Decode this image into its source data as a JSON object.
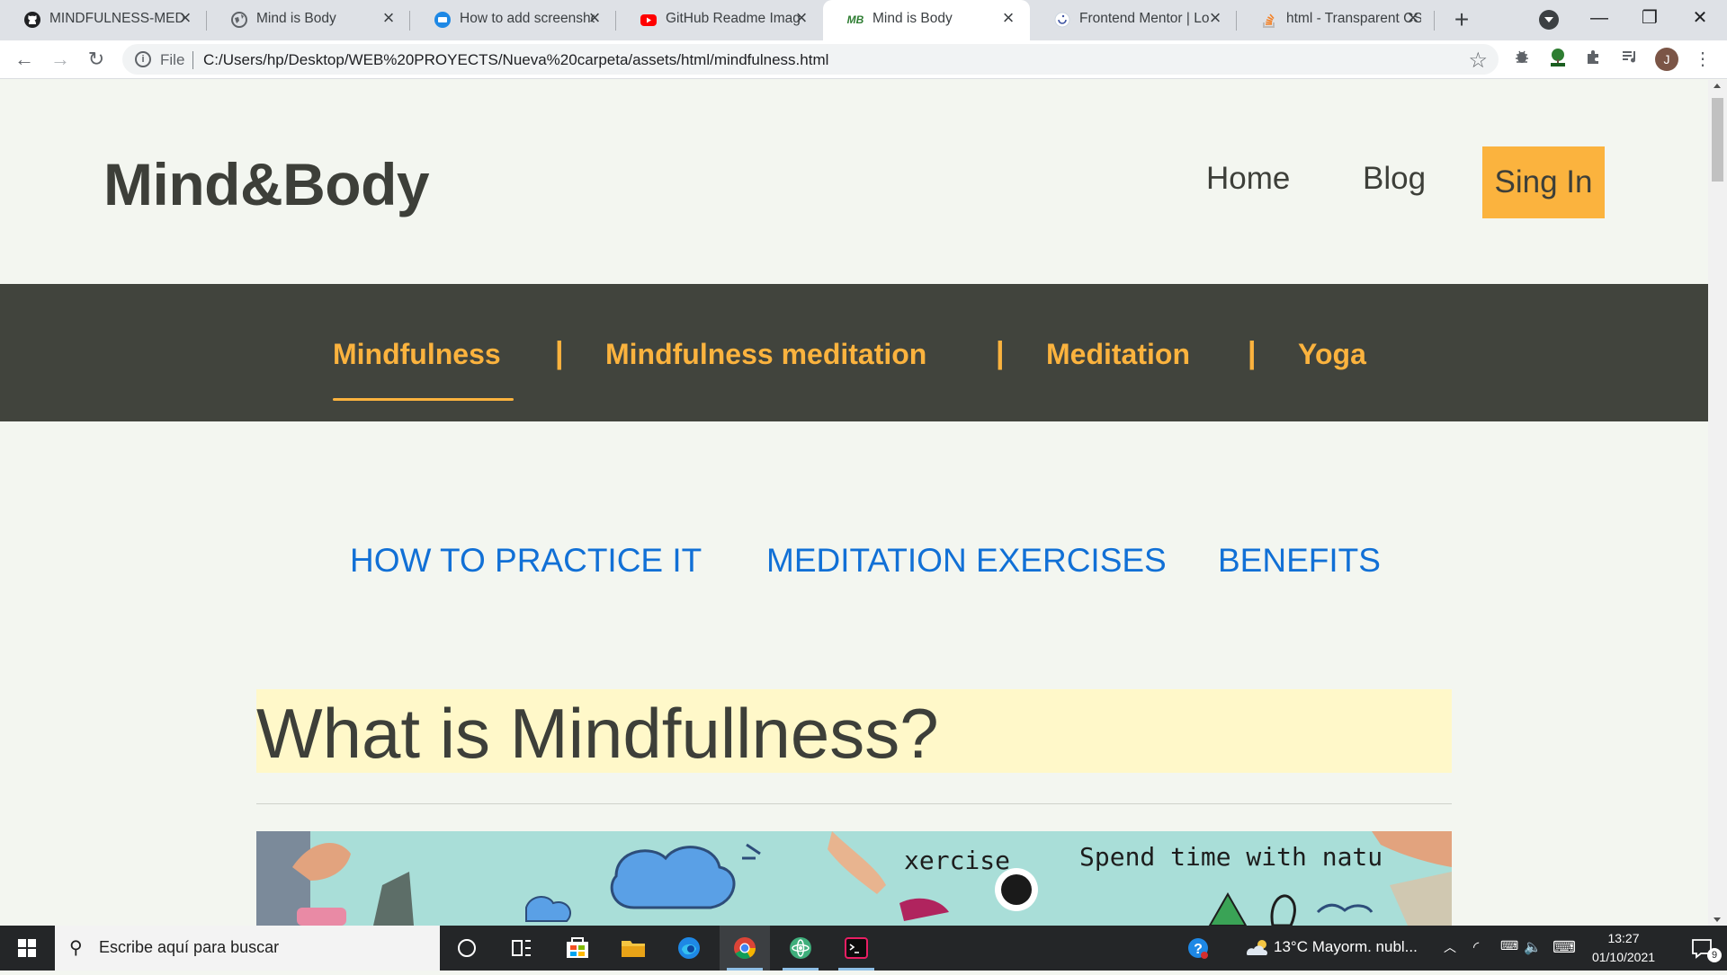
{
  "browser": {
    "tabs": [
      {
        "title": "MINDFULNESS-MEDIT",
        "icon": "github-icon",
        "active": false
      },
      {
        "title": "Mind is Body",
        "icon": "globe-icon",
        "active": false
      },
      {
        "title": "How to add screensho",
        "icon": "site-icon",
        "active": false
      },
      {
        "title": "GitHub Readme Image",
        "icon": "youtube-icon",
        "active": false
      },
      {
        "title": "Mind is Body",
        "icon": "mb-logo-icon",
        "favicon_text": "MB",
        "active": true
      },
      {
        "title": "Frontend Mentor | Lo",
        "icon": "frontend-mentor-icon",
        "active": false
      },
      {
        "title": "html - Transparent CS",
        "icon": "stackoverflow-icon",
        "active": false
      }
    ],
    "new_tab_label": "+",
    "omnibox": {
      "scheme_label": "File",
      "url": "C:/Users/hp/Desktop/WEB%20PROYECTS/Nueva%20carpeta/assets/html/mindfulness.html"
    },
    "profile_initial": "J"
  },
  "site": {
    "logo": "Mind&Body",
    "nav": {
      "home": "Home",
      "blog": "Blog",
      "signin": "Sing In"
    },
    "categories": [
      "Mindfulness",
      "Mindfulness meditation",
      "Meditation",
      "Yoga"
    ],
    "category_separator": "|",
    "active_category": "Mindfulness",
    "section_links": [
      "HOW TO PRACTICE IT",
      "MEDITATION EXERCISES",
      "BENEFITS"
    ],
    "heading": "What is Mindfullness?",
    "banner_text": {
      "exercise": "xercise",
      "nature": "Spend time with natu"
    },
    "colors": {
      "accent": "#fbb33e",
      "dark": "#41443d",
      "link": "#1170d6",
      "highlight": "#fff8c9",
      "background": "#f3f6f0"
    }
  },
  "taskbar": {
    "search_placeholder": "Escribe aquí para buscar",
    "weather": "13°C  Mayorm. nubl...",
    "time": "13:27",
    "date": "01/10/2021",
    "notification_count": "9"
  }
}
